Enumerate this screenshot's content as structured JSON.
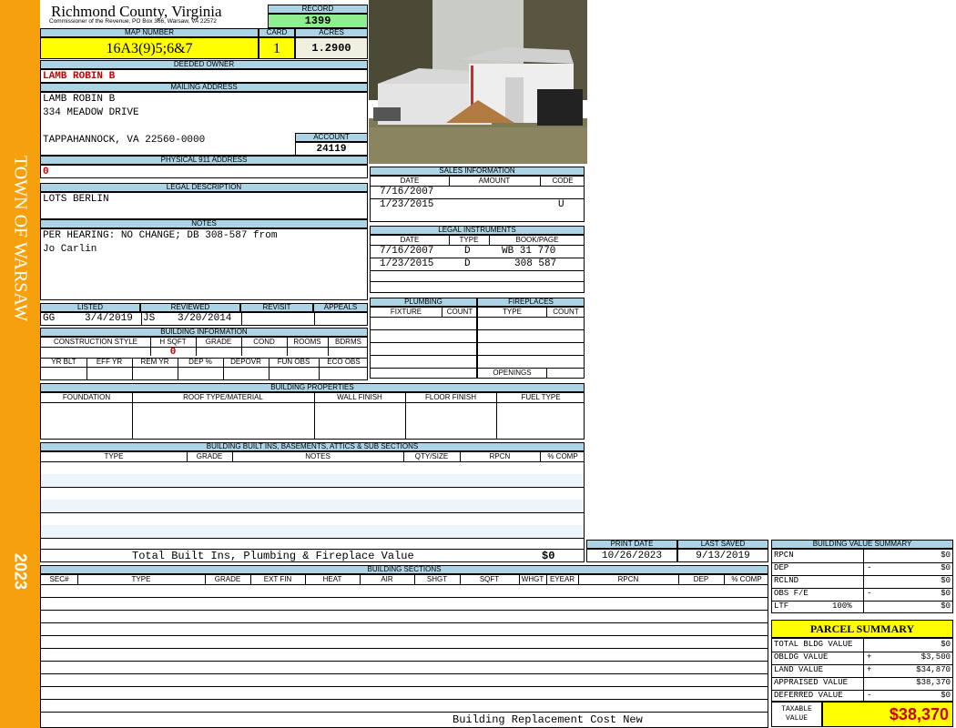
{
  "sidebar": {
    "town": "TOWN OF WARSAW",
    "year": "2023"
  },
  "header": {
    "county": "Richmond County, Virginia",
    "commissioner": "Commissioner of the Revenue, PO Box 366, Warsaw, VA 22572",
    "record_label": "RECORD",
    "record": "1399",
    "map_label": "MAP NUMBER",
    "map_number": "16A3(9)5;6&7",
    "card_label": "CARD",
    "card": "1",
    "acres_label": "ACRES",
    "acres": "1.2900"
  },
  "owner": {
    "label": "DEEDED OWNER",
    "name": "LAMB ROBIN B"
  },
  "mailing": {
    "label": "MAILING ADDRESS",
    "line1": "LAMB ROBIN B",
    "line2": "334 MEADOW DRIVE",
    "line3": "TAPPAHANNOCK, VA 22560-0000",
    "account_label": "ACCOUNT",
    "account": "24119"
  },
  "physical": {
    "label": "PHYSICAL 911 ADDRESS",
    "value": "0"
  },
  "legal": {
    "label": "LEGAL DESCRIPTION",
    "value": "LOTS BERLIN"
  },
  "notes": {
    "label": "NOTES",
    "line1": "PER HEARING: NO CHANGE; DB 308-587 from",
    "line2": "Jo Carlin"
  },
  "listed": {
    "listed_label": "LISTED",
    "reviewed_label": "REVIEWED",
    "revisit_label": "REVISIT",
    "appeals_label": "APPEALS",
    "listed_by": "GG",
    "listed_date": "3/4/2019",
    "reviewed_by": "JS",
    "reviewed_date": "3/20/2014"
  },
  "building_info": {
    "label": "BUILDING INFORMATION",
    "cols1": [
      "CONSTRUCTION STYLE",
      "H SQFT",
      "GRADE",
      "COND",
      "ROOMS",
      "BDRMS"
    ],
    "hsqft": "0",
    "cols2": [
      "YR BLT",
      "EFF YR",
      "REM YR",
      "DEP %",
      "DEPOVR",
      "FUN OBS",
      "ECO OBS"
    ]
  },
  "sales": {
    "label": "SALES INFORMATION",
    "cols": [
      "DATE",
      "AMOUNT",
      "CODE"
    ],
    "rows": [
      {
        "date": "7/16/2007",
        "amount": "",
        "code": ""
      },
      {
        "date": "1/23/2015",
        "amount": "",
        "code": "U"
      }
    ]
  },
  "legal_instruments": {
    "label": "LEGAL INSTRUMENTS",
    "cols": [
      "DATE",
      "TYPE",
      "BOOK/PAGE"
    ],
    "rows": [
      {
        "date": "7/16/2007",
        "type": "D",
        "book": "WB 31 770"
      },
      {
        "date": "1/23/2015",
        "type": "D",
        "book": "308 587"
      }
    ]
  },
  "plumbing": {
    "label": "PLUMBING",
    "cols": [
      "FIXTURE",
      "COUNT"
    ]
  },
  "fireplaces": {
    "label": "FIREPLACES",
    "cols": [
      "TYPE",
      "COUNT"
    ],
    "openings": "OPENINGS"
  },
  "building_properties": {
    "label": "BUILDING PROPERTIES",
    "cols": [
      "FOUNDATION",
      "ROOF TYPE/MATERIAL",
      "WALL FINISH",
      "FLOOR FINISH",
      "FUEL TYPE"
    ]
  },
  "builtins": {
    "label": "BUILDING BUILT INS, BASEMENTS, ATTICS & SUB SECTIONS",
    "cols": [
      "TYPE",
      "GRADE",
      "NOTES",
      "QTY/SIZE",
      "RPCN",
      "% COMP"
    ],
    "total_label": "Total Built Ins, Plumbing & Fireplace Value",
    "total_value": "$0"
  },
  "print": {
    "print_label": "PRINT DATE",
    "print_date": "10/26/2023",
    "saved_label": "LAST SAVED",
    "saved_date": "9/13/2019"
  },
  "sections": {
    "label": "BUILDING SECTIONS",
    "cols": [
      "SEC#",
      "TYPE",
      "GRADE",
      "EXT FIN",
      "HEAT",
      "AIR",
      "SHGT",
      "SQFT",
      "WHGT",
      "EYEAR",
      "RPCN",
      "DEP",
      "% COMP"
    ],
    "footer": "Building Replacement Cost New"
  },
  "value_summary": {
    "label": "BUILDING VALUE SUMMARY",
    "rows": [
      {
        "label": "RPCN",
        "op": "",
        "value": "$0"
      },
      {
        "label": "DEP",
        "op": "-",
        "value": "$0"
      },
      {
        "label": "RCLND",
        "op": "",
        "value": "$0"
      },
      {
        "label": "OBS F/E",
        "op": "-",
        "value": "$0"
      },
      {
        "label": "LTF",
        "pct": "100%",
        "op": "",
        "value": "$0"
      }
    ]
  },
  "parcel": {
    "label": "PARCEL SUMMARY",
    "rows": [
      {
        "label": "TOTAL BLDG VALUE",
        "op": "",
        "value": "$0"
      },
      {
        "label": "OBLDG VALUE",
        "op": "+",
        "value": "$3,500"
      },
      {
        "label": "LAND VALUE",
        "op": "+",
        "value": "$34,870"
      },
      {
        "label": "APPRAISED VALUE",
        "op": "",
        "value": "$38,370"
      },
      {
        "label": "DEFERRED VALUE",
        "op": "-",
        "value": "$0"
      }
    ],
    "taxable_label1": "TAXABLE",
    "taxable_label2": "VALUE",
    "taxable": "$38,370"
  },
  "colors": {
    "sidebar": "#f5a00c",
    "header_bg": "#acd4e4",
    "record_bg": "#90ee90",
    "highlight": "#ffff00",
    "red": "#cc0000"
  }
}
